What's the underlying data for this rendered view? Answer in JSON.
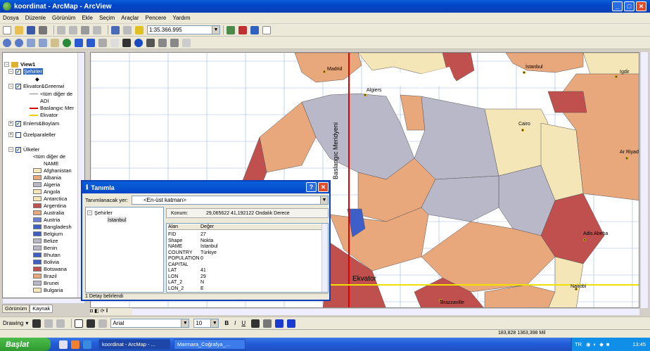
{
  "window": {
    "title": "koordinat - ArcMap - ArcView",
    "controls": [
      "minimize",
      "maximize",
      "close"
    ]
  },
  "menu": [
    "Dosya",
    "Düzenle",
    "Görünüm",
    "Ekle",
    "Seçim",
    "Araçlar",
    "Pencere",
    "Yardım"
  ],
  "standard_toolbar": {
    "scale_value": "1:35.366.995"
  },
  "toc": {
    "data_frame": "View1",
    "layers": [
      {
        "name": "Şehirler",
        "checked": true,
        "selected": true
      },
      {
        "name": "Ekvator&Greenwi",
        "checked": true
      },
      {
        "name": "<tüm diğer de"
      },
      {
        "name": "ADI"
      },
      {
        "name": "Baslangıc Mer"
      },
      {
        "name": "Ekvator"
      },
      {
        "name": "Enlem&Boylam",
        "checked": true
      },
      {
        "name": "Özelparaleller",
        "checked": false
      },
      {
        "name": "Ülkeler",
        "checked": true
      },
      {
        "name": "<tüm diğer de"
      },
      {
        "name": "NAME"
      }
    ],
    "countries": [
      {
        "name": "Afghanistan",
        "color": "#f5e6b8"
      },
      {
        "name": "Albania",
        "color": "#e8a87c"
      },
      {
        "name": "Algeria",
        "color": "#b8b8c8"
      },
      {
        "name": "Angola",
        "color": "#f5e6b8"
      },
      {
        "name": "Antarctica",
        "color": "#f5e6b8"
      },
      {
        "name": "Argentina",
        "color": "#c0504d"
      },
      {
        "name": "Australia",
        "color": "#e8a87c"
      },
      {
        "name": "Austria",
        "color": "#6b7fd7"
      },
      {
        "name": "Bangladesh",
        "color": "#3f5fc8"
      },
      {
        "name": "Belgium",
        "color": "#3f5fc8"
      },
      {
        "name": "Belize",
        "color": "#b8b8c8"
      },
      {
        "name": "Benin",
        "color": "#b8b8c8"
      },
      {
        "name": "Bhutan",
        "color": "#3f5fc8"
      },
      {
        "name": "Bolivia",
        "color": "#3f5fc8"
      },
      {
        "name": "Botswana",
        "color": "#c0504d"
      },
      {
        "name": "Brazil",
        "color": "#e8a87c"
      },
      {
        "name": "Brunei",
        "color": "#b8b8c8"
      },
      {
        "name": "Bulgaria",
        "color": "#f5e6b8"
      }
    ],
    "tabs": [
      "Görünüm",
      "Kaynak"
    ]
  },
  "map": {
    "cities": [
      "Madrid",
      "Algiers",
      "Cairo",
      "Ar Riyad",
      "Adis Abeba",
      "Nairobi",
      "Brazzaville",
      "İstanbul",
      "Igdir"
    ],
    "meridian_label": "Baslangıc Meridyeni",
    "equator_label": "Ekvator"
  },
  "identify": {
    "title": "Tanımla",
    "identify_from_label": "Tanımlanacak yer:",
    "identify_from_value": "<En-üst katman>",
    "tree_root": "Şehirler",
    "tree_child": "İstanbul",
    "location_label": "Konum:",
    "location_value": "29,065622  41,192122 Ondalık Derece",
    "col_field": "Alan",
    "col_value": "Değer",
    "rows": [
      {
        "k": "FID",
        "v": "27"
      },
      {
        "k": "Shape",
        "v": "Nokta"
      },
      {
        "k": "NAME",
        "v": "İstanbul"
      },
      {
        "k": "COUNTRY",
        "v": "Türkiye"
      },
      {
        "k": "POPULATION",
        "v": "0"
      },
      {
        "k": "CAPITAL",
        "v": ""
      },
      {
        "k": "LAT",
        "v": "41"
      },
      {
        "k": "LON",
        "v": "29"
      },
      {
        "k": "LAT_2",
        "v": "N"
      },
      {
        "k": "LON_2",
        "v": "E"
      }
    ],
    "status": "1 Detay belirlendi"
  },
  "drawing_toolbar": {
    "drawing_label": "Drawing",
    "font": "Arial",
    "size": "10"
  },
  "status_bar": {
    "coords": "183,828  1363,398 Mil"
  },
  "taskbar": {
    "start": "Başlat",
    "tasks": [
      "koordinat - ArcMap - ...",
      "Marmara_Coğrafya_..."
    ],
    "lang": "TR",
    "clock": "13:45"
  }
}
